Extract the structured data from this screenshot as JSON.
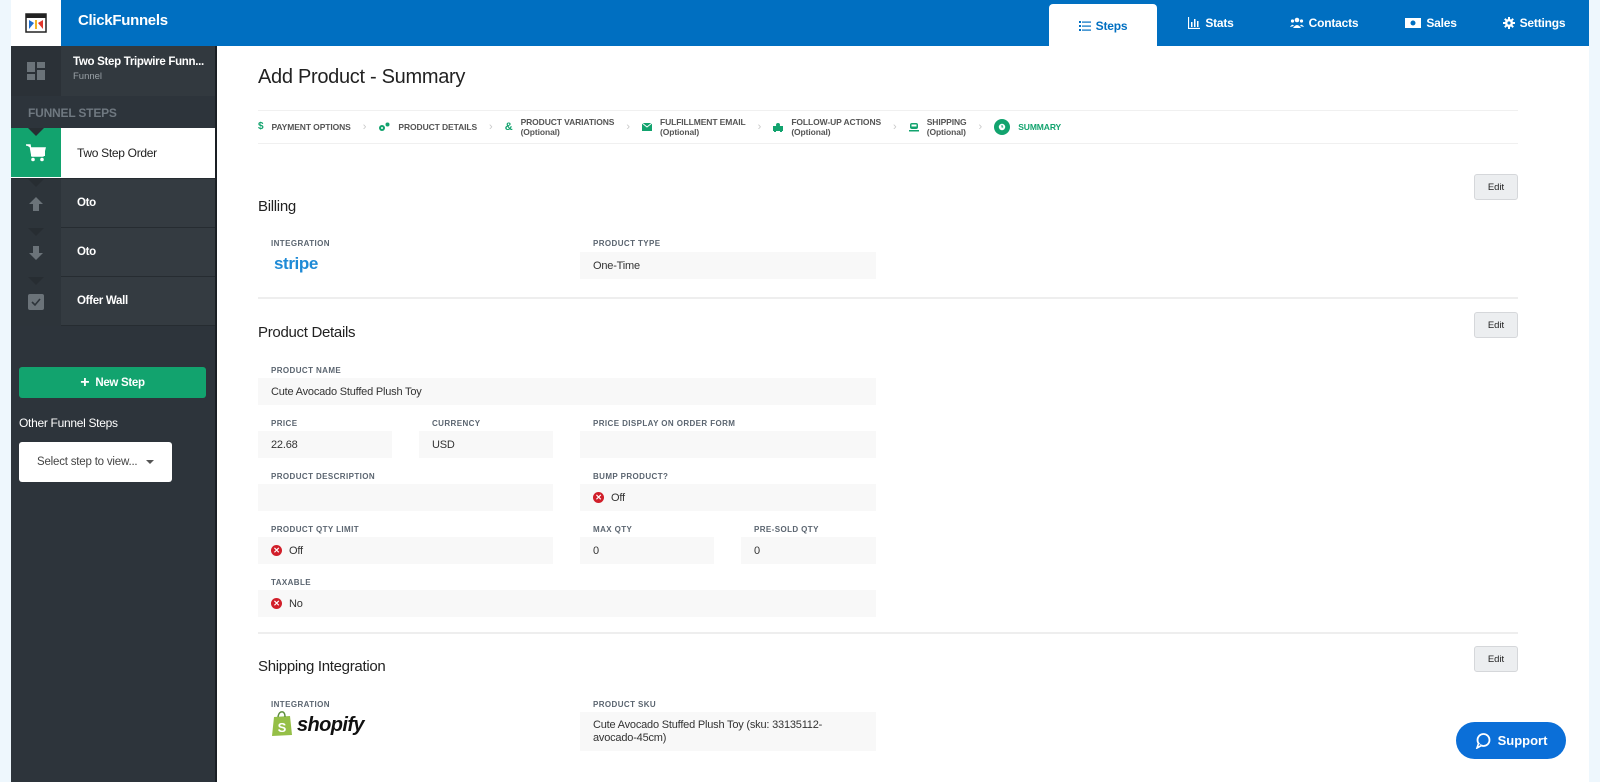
{
  "brand": {
    "name": "ClickFunnels",
    "logo_icon": "clickfunnels-logo-icon"
  },
  "nav": {
    "items": [
      {
        "label": "Steps",
        "icon": "list-icon",
        "active": true
      },
      {
        "label": "Stats",
        "icon": "bar-chart-icon",
        "active": false
      },
      {
        "label": "Contacts",
        "icon": "users-icon",
        "active": false
      },
      {
        "label": "Sales",
        "icon": "money-icon",
        "active": false
      },
      {
        "label": "Settings",
        "icon": "gear-icon",
        "active": false
      }
    ]
  },
  "sidebar": {
    "funnel_name": "Two Step Tripwire Funn...",
    "funnel_type": "Funnel",
    "section_label": "FUNNEL STEPS",
    "steps": [
      {
        "label": "Two Step Order",
        "icon": "cart-icon",
        "active": true
      },
      {
        "label": "Oto",
        "icon": "arrow-up-icon",
        "active": false
      },
      {
        "label": "Oto",
        "icon": "arrow-down-icon",
        "active": false
      },
      {
        "label": "Offer Wall",
        "icon": "checkbox-icon",
        "active": false
      }
    ],
    "new_step_label": "New Step",
    "other_steps_label": "Other Funnel Steps",
    "select_placeholder": "Select step to view..."
  },
  "page": {
    "title": "Add Product - Summary",
    "wizard": [
      {
        "label": "PAYMENT OPTIONS",
        "sub": "",
        "icon": "dollar-icon"
      },
      {
        "label": "PRODUCT DETAILS",
        "sub": "",
        "icon": "gears-icon"
      },
      {
        "label": "PRODUCT VARIATIONS",
        "sub": "(Optional)",
        "icon": "ampersand-icon"
      },
      {
        "label": "FULFILLMENT EMAIL",
        "sub": "(Optional)",
        "icon": "envelope-icon"
      },
      {
        "label": "FOLLOW-UP ACTIONS",
        "sub": "(Optional)",
        "icon": "puzzle-icon"
      },
      {
        "label": "SHIPPING",
        "sub": "(Optional)",
        "icon": "truck-icon"
      },
      {
        "label": "SUMMARY",
        "sub": "",
        "icon": "clock-icon",
        "current": true
      }
    ]
  },
  "billing": {
    "title": "Billing",
    "edit_label": "Edit",
    "integration_label": "INTEGRATION",
    "integration_value": "stripe",
    "product_type_label": "PRODUCT TYPE",
    "product_type_value": "One-Time"
  },
  "product_details": {
    "title": "Product Details",
    "edit_label": "Edit",
    "product_name_label": "PRODUCT NAME",
    "product_name_value": "Cute Avocado Stuffed Plush Toy",
    "price_label": "PRICE",
    "price_value": "22.68",
    "currency_label": "CURRENCY",
    "currency_value": "USD",
    "price_display_label": "PRICE DISPLAY ON ORDER FORM",
    "price_display_value": "",
    "description_label": "PRODUCT DESCRIPTION",
    "description_value": "",
    "bump_label": "BUMP PRODUCT?",
    "bump_value": "Off",
    "qty_limit_label": "PRODUCT QTY LIMIT",
    "qty_limit_value": "Off",
    "max_qty_label": "MAX QTY",
    "max_qty_value": "0",
    "presold_label": "PRE-SOLD QTY",
    "presold_value": "0",
    "taxable_label": "TAXABLE",
    "taxable_value": "No"
  },
  "shipping": {
    "title": "Shipping Integration",
    "edit_label": "Edit",
    "integration_label": "INTEGRATION",
    "integration_value": "shopify",
    "sku_label": "PRODUCT SKU",
    "sku_value": "Cute Avocado Stuffed Plush Toy (sku: 33135112-avocado-45cm)"
  },
  "support": {
    "label": "Support"
  },
  "colors": {
    "brand_blue": "#006fc1",
    "accent_green": "#12a36e",
    "sidebar_dark": "#2d343b",
    "error_red": "#d11f2a",
    "stripe_blue": "#1e8ad6",
    "support_blue": "#0b6fd8"
  }
}
